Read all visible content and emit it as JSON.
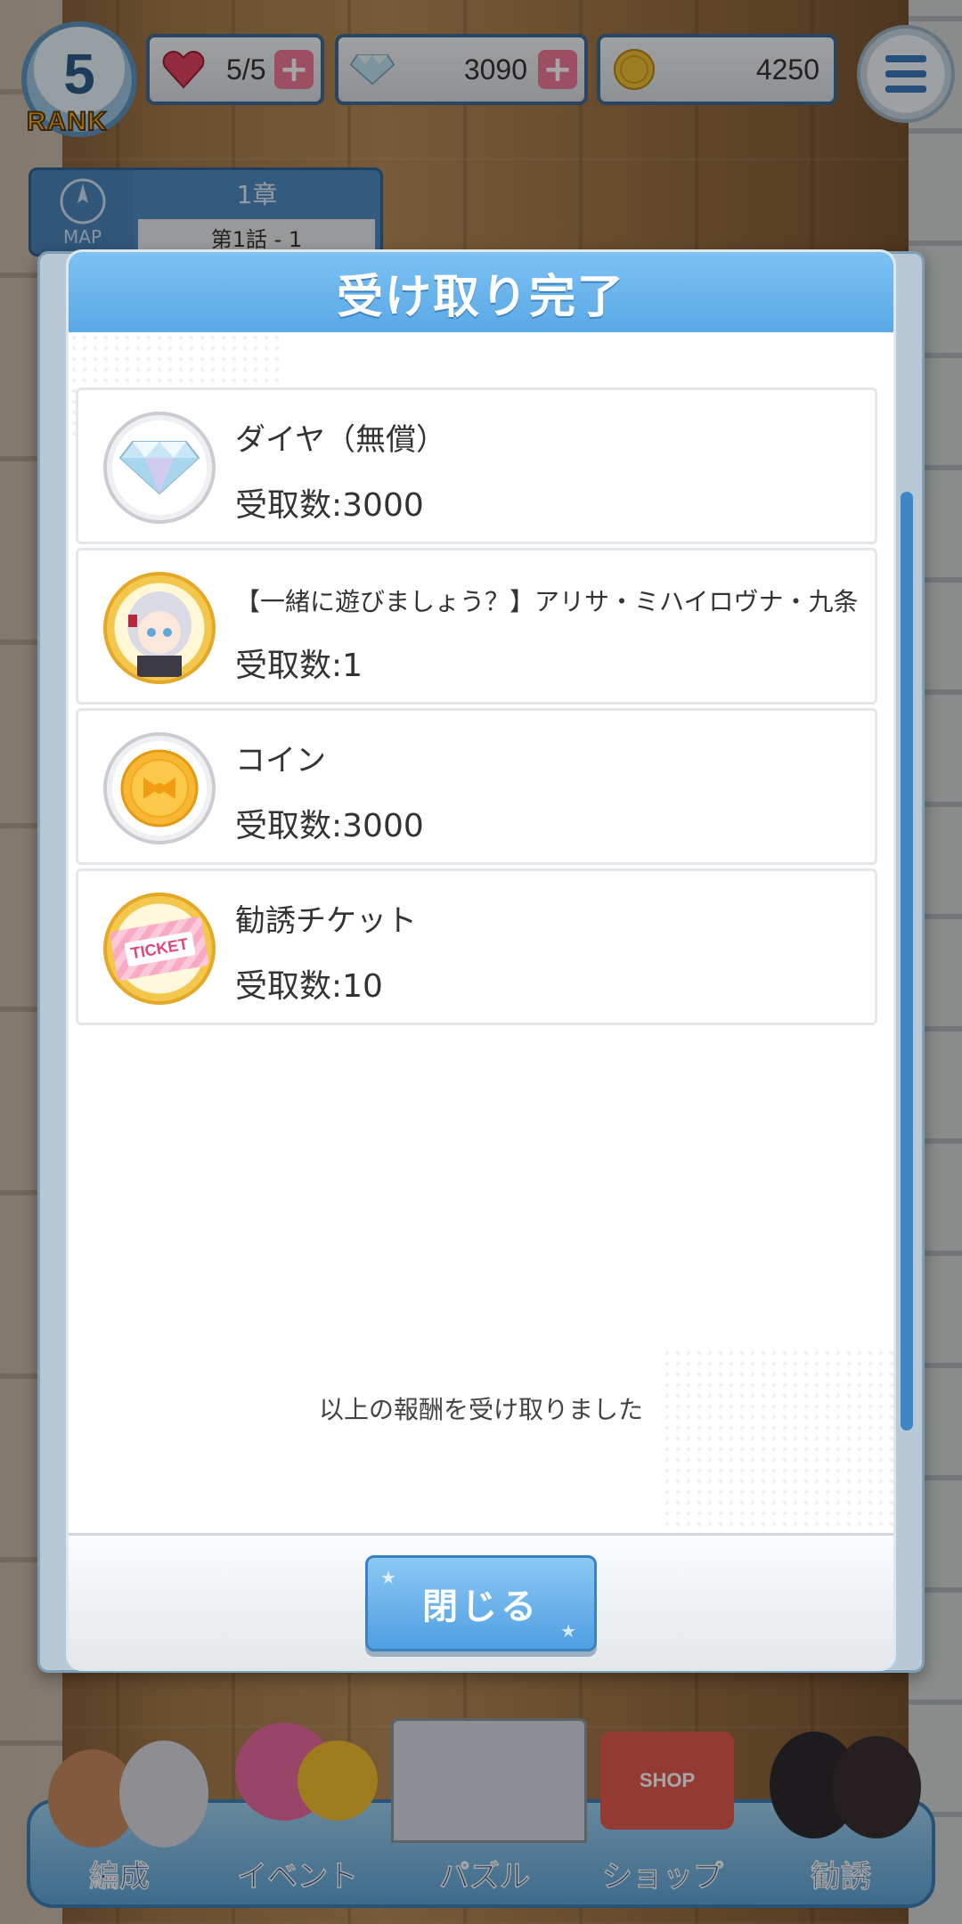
{
  "hud": {
    "rank_number": "5",
    "rank_label": "RANK",
    "stamina": "5/5",
    "diamonds": "3090",
    "coins": "4250"
  },
  "map": {
    "map_label": "MAP",
    "chapter": "1章",
    "episode": "第1話 - 1"
  },
  "modal": {
    "title": "受け取り完了",
    "message": "以上の報酬を受け取りました",
    "close_label": "閉じる",
    "rewards": [
      {
        "name": "ダイヤ（無償）",
        "count": "受取数:3000",
        "icon": "diamond-icon"
      },
      {
        "name": "【一緒に遊びましょう？】アリサ・ミハイロヴナ・九条",
        "count": "受取数:1",
        "icon": "character-icon"
      },
      {
        "name": "コイン",
        "count": "受取数:3000",
        "icon": "coin-icon"
      },
      {
        "name": "勧誘チケット",
        "count": "受取数:10",
        "icon": "ticket-icon"
      }
    ],
    "ticket_text": "TICKET"
  },
  "nav": {
    "items": [
      "編成",
      "イベント",
      "パズル",
      "ショップ",
      "勧誘"
    ],
    "shop_sign": "SHOP"
  },
  "colors": {
    "accent_blue": "#5aa8e6",
    "plus_pink": "#f07a98",
    "coin_gold": "#f3b02a"
  }
}
